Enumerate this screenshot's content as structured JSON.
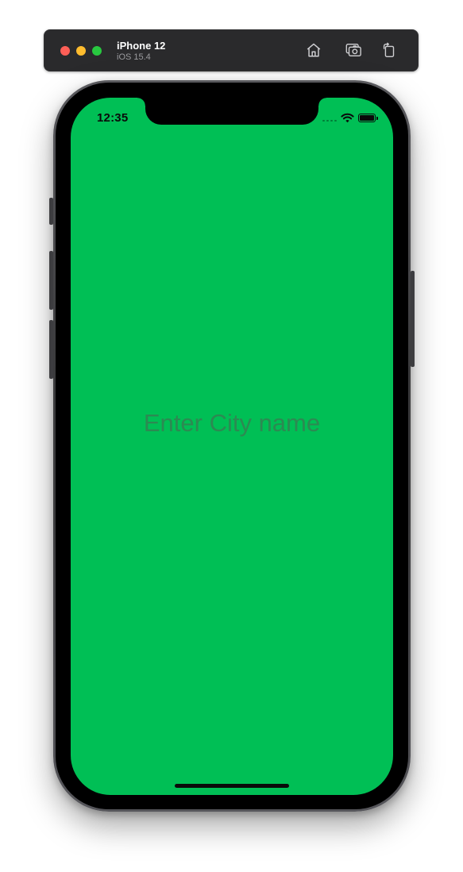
{
  "simulator": {
    "device_name": "iPhone 12",
    "os_version": "iOS 15.4",
    "toolbar_icons": [
      "home-icon",
      "screenshot-icon",
      "rotate-icon"
    ]
  },
  "status_bar": {
    "time": "12:35",
    "icons": [
      "signal-icon",
      "wifi-icon",
      "battery-icon"
    ]
  },
  "main": {
    "city_input": {
      "placeholder": "Enter City name",
      "value": ""
    }
  },
  "colors": {
    "screen_background": "#00bf55",
    "placeholder_text": "#2c8a52",
    "titlebar": "#2a2a2c"
  }
}
